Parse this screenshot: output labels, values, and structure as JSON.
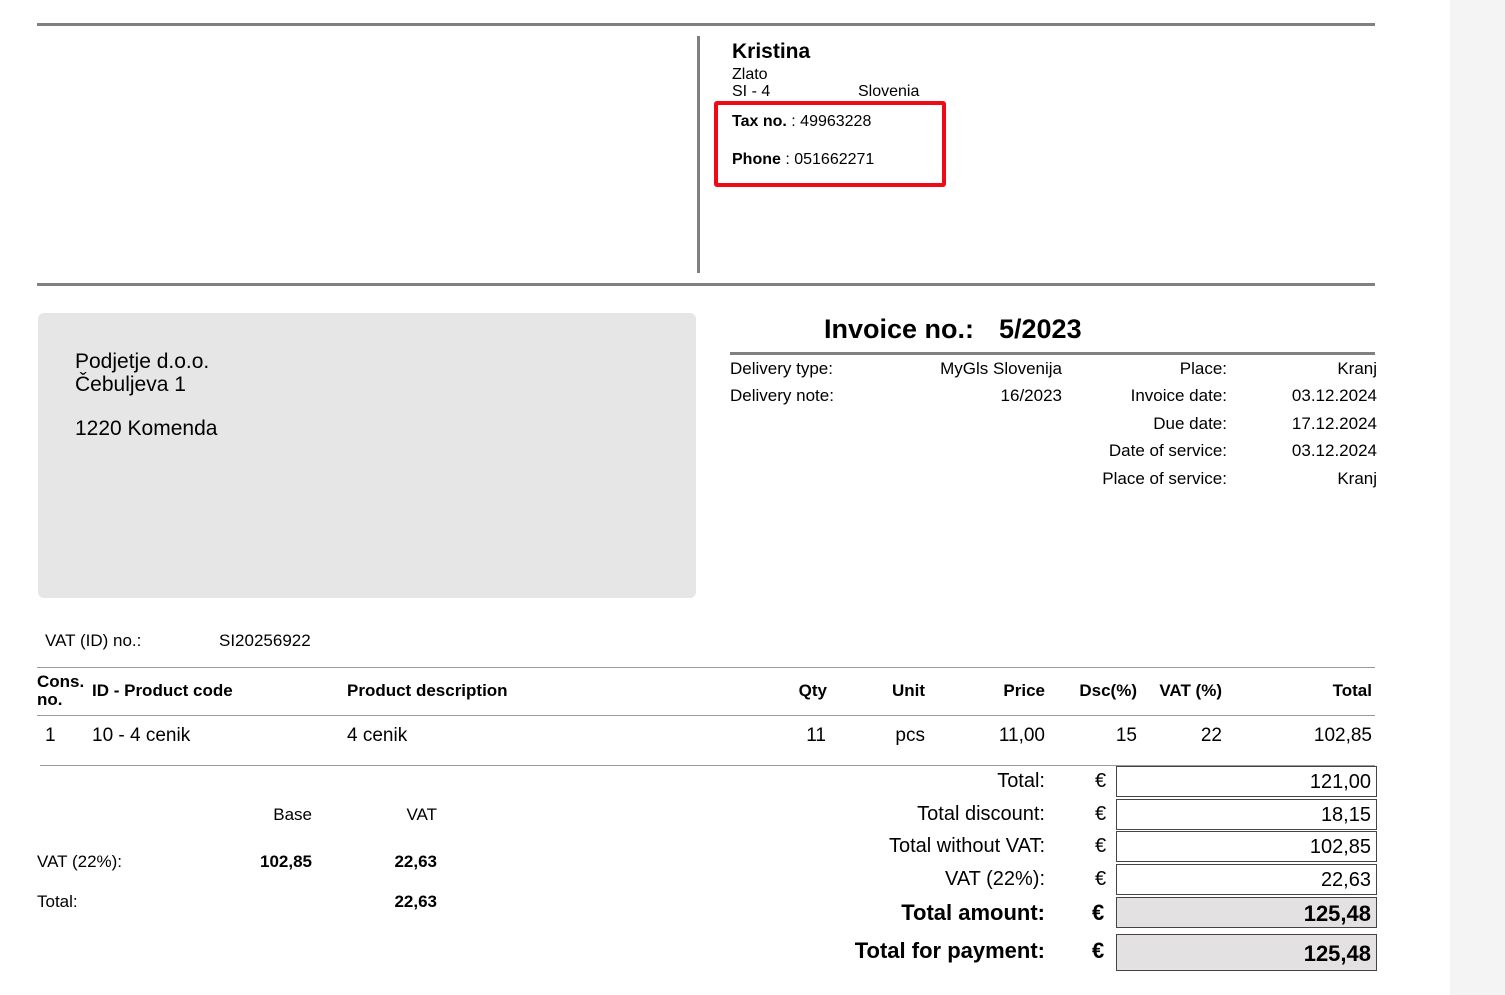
{
  "seller": {
    "name": "Kristina",
    "street": "Zlato",
    "postal": "SI - 4",
    "country": "Slovenia",
    "tax_label": "Tax no.",
    "tax_value": " : 49963228",
    "phone_label": "Phone",
    "phone_value": " : 051662271"
  },
  "buyer": {
    "line1": "Podjetje d.o.o.",
    "line2": "Čebuljeva 1",
    "line3": "1220 Komenda",
    "vat_label": "VAT (ID) no.:",
    "vat_value": "SI20256922"
  },
  "invoice": {
    "title": "Invoice no.:",
    "number": "5/2023",
    "delivery_type_label": "Delivery type:",
    "delivery_type_value": "MyGls Slovenija",
    "delivery_note_label": "Delivery note:",
    "delivery_note_value": "16/2023",
    "place_label": "Place:",
    "place_value": "Kranj",
    "invoice_date_label": "Invoice date:",
    "invoice_date_value": "03.12.2024",
    "due_date_label": "Due date:",
    "due_date_value": "17.12.2024",
    "service_date_label": "Date of service:",
    "service_date_value": "03.12.2024",
    "service_place_label": "Place of service:",
    "service_place_value": "Kranj"
  },
  "table": {
    "headers": {
      "cons1": "Cons.",
      "cons2": "no.",
      "code": "ID - Product code",
      "desc": "Product description",
      "qty": "Qty",
      "unit": "Unit",
      "price": "Price",
      "dsc": "Dsc(%)",
      "vat": "VAT (%)",
      "total": "Total"
    },
    "rows": [
      {
        "no": "1",
        "code": "10 - 4 cenik",
        "desc": "4 cenik",
        "qty": "11",
        "unit": "pcs",
        "price": "11,00",
        "dsc": "15",
        "vat": "22",
        "total": "102,85"
      }
    ]
  },
  "vat_summary": {
    "base_header": "Base",
    "vat_header": "VAT",
    "row_label": "VAT (22%):",
    "row_base": "102,85",
    "row_vat": "22,63",
    "total_label": "Total:",
    "total_vat": "22,63"
  },
  "totals": {
    "currency": "€",
    "total_label": "Total:",
    "total_value": "121,00",
    "discount_label": "Total discount:",
    "discount_value": "18,15",
    "without_vat_label": "Total without VAT:",
    "without_vat_value": "102,85",
    "vat_label": "VAT (22%):",
    "vat_value": "22,63",
    "amount_label": "Total amount:",
    "amount_value": "125,48",
    "payment_label": "Total for payment:",
    "payment_value": "125,48"
  }
}
